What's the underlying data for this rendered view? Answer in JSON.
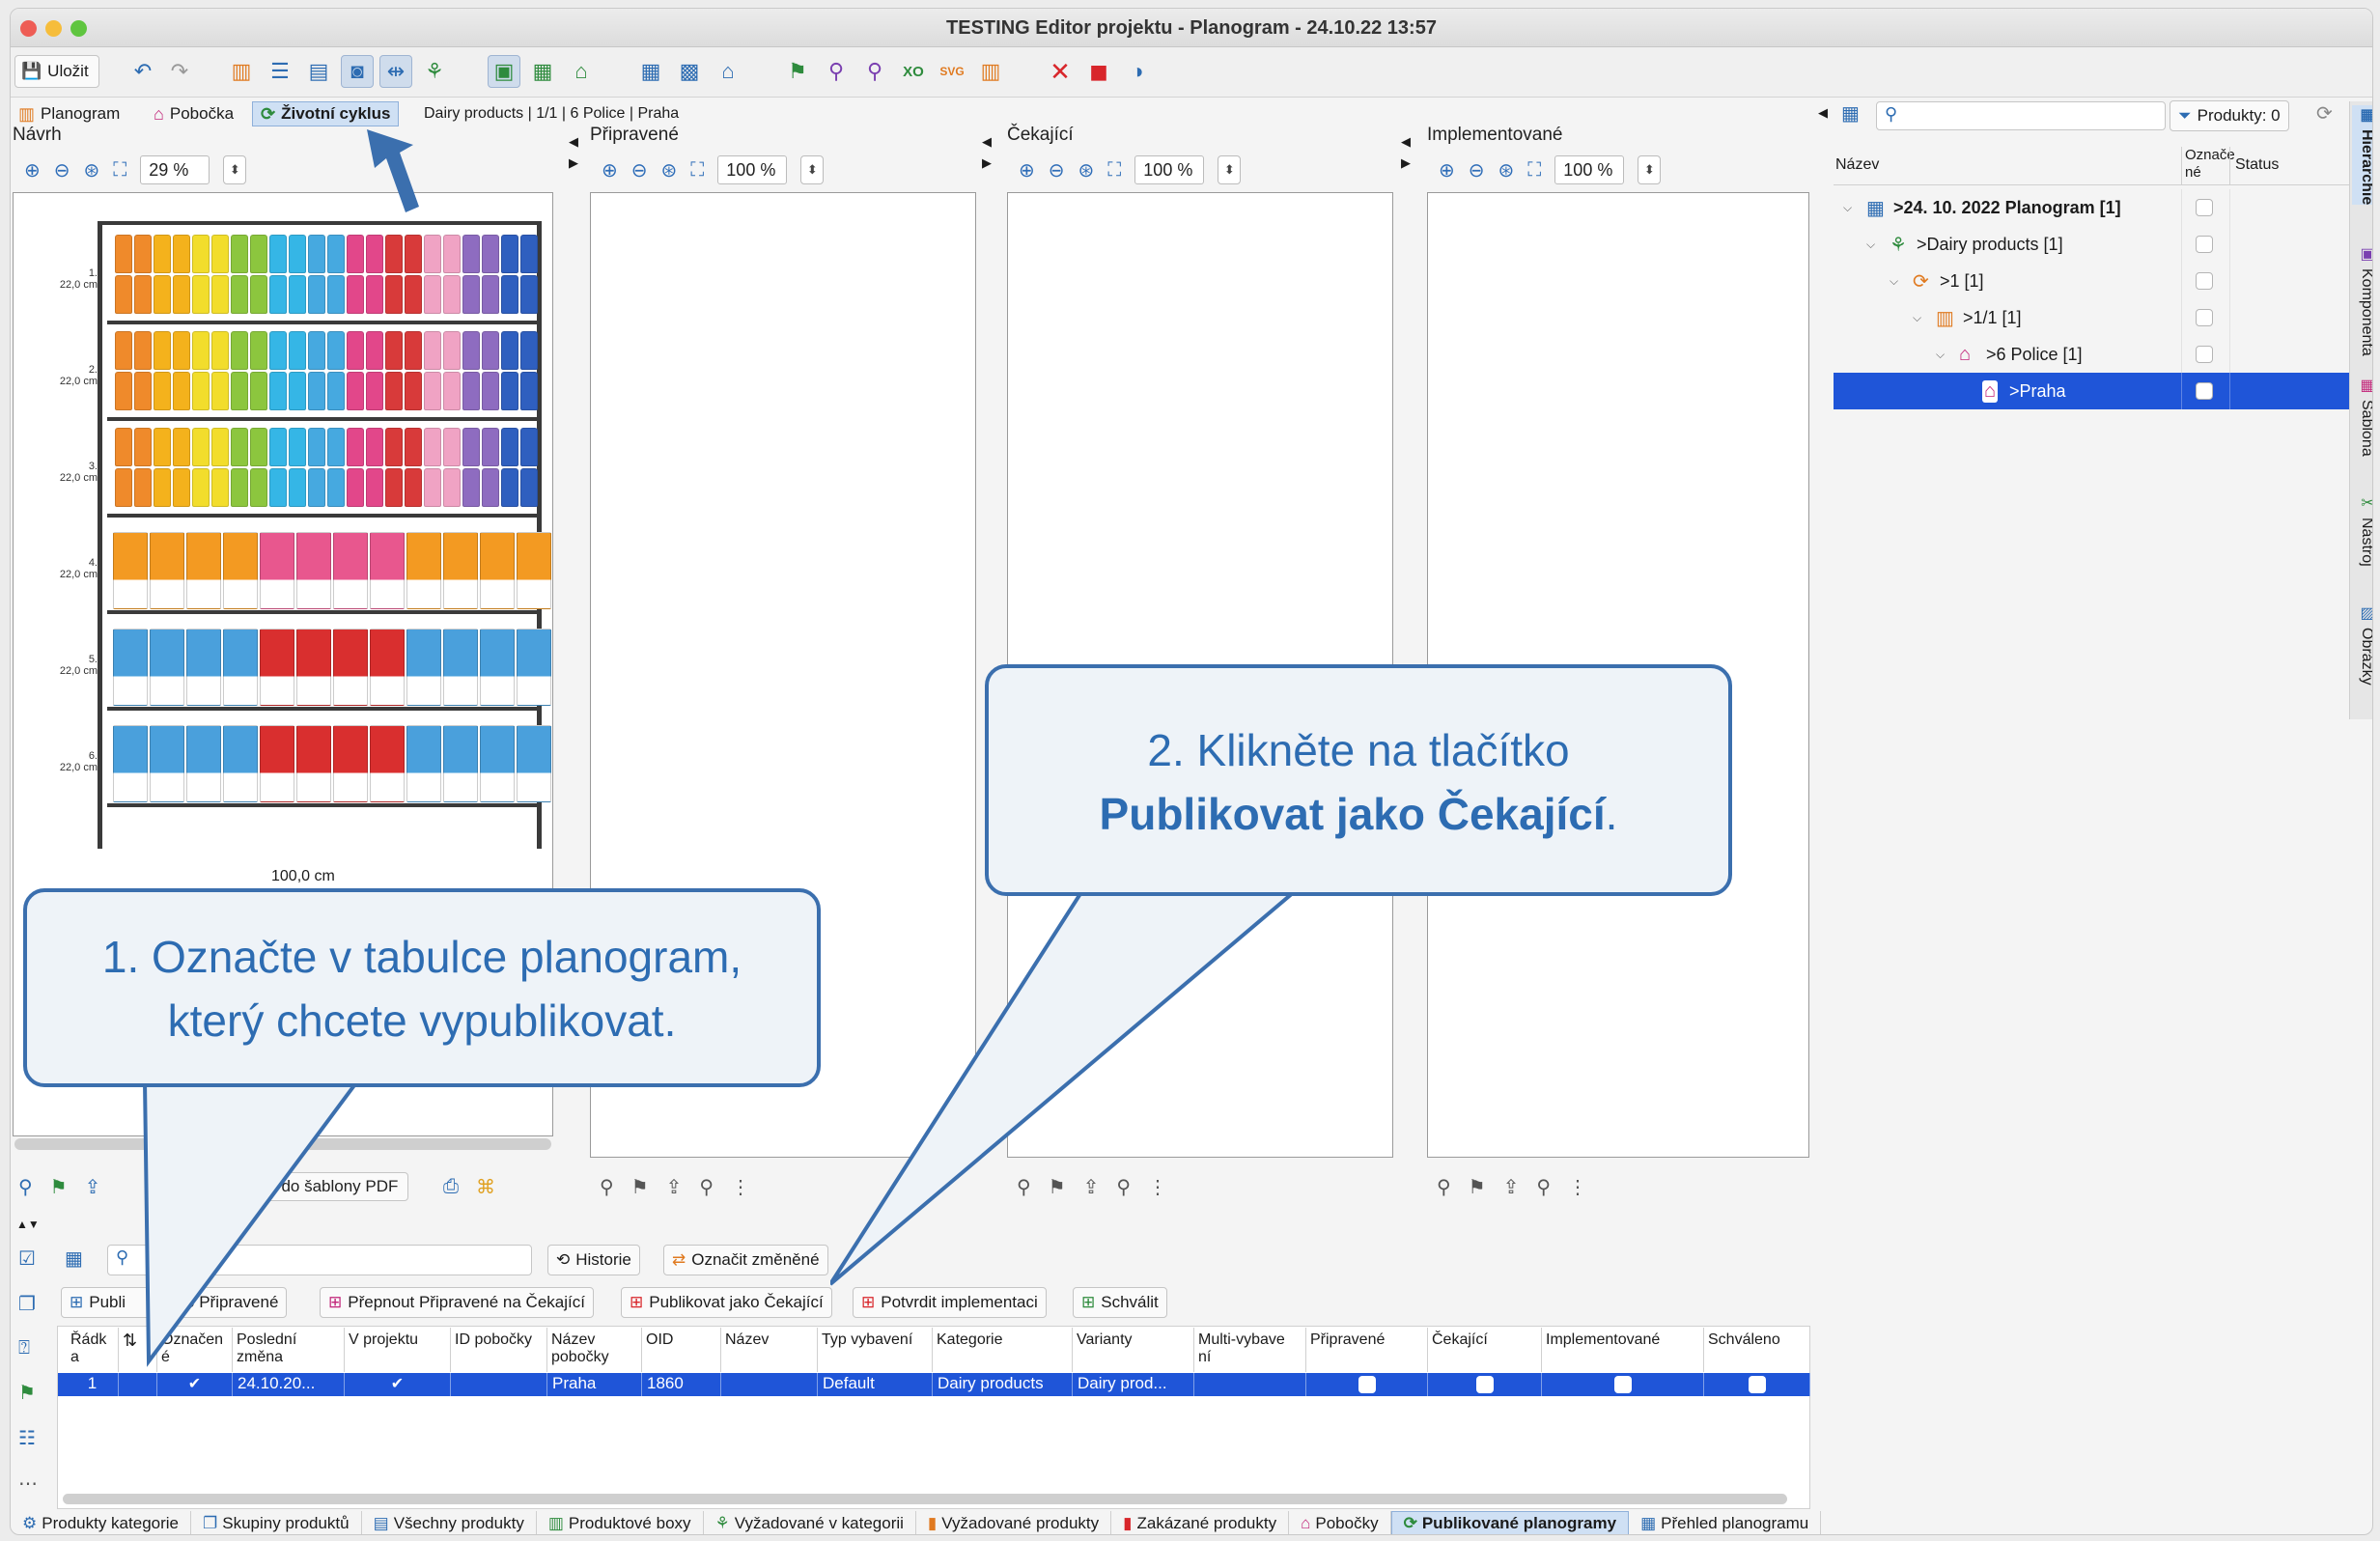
{
  "window": {
    "title": "TESTING Editor projektu - Planogram - 24.10.22 13:57"
  },
  "toolbar": {
    "save_label": "Uložit",
    "icons": [
      "undo-icon",
      "redo-icon",
      "align-icon",
      "list-icon",
      "columns-icon",
      "camera-icon",
      "ruler-icon",
      "tree-icon",
      "image-icon",
      "grid-icon",
      "home-icon",
      "table-icon",
      "map-icon",
      "store-icon",
      "flag-icon",
      "chart-icon",
      "chart2-icon",
      "xo-icon",
      "svg-icon",
      "shelf-icon",
      "close-icon",
      "stop-icon",
      "eye-off-icon"
    ]
  },
  "tabs": {
    "planogram": "Planogram",
    "pobocka": "Pobočka",
    "zivotni_cyklus": "Životní cyklus",
    "breadcrumb": "Dairy products | 1/1 | 6 Police | Praha"
  },
  "panels": {
    "navrh": {
      "label": "Návrh",
      "zoom": "29 %",
      "width_label": "100,0 cm",
      "pdf_button": "t do šablony PDF"
    },
    "pripravene": {
      "label": "Připravené",
      "zoom": "100 %"
    },
    "cekajici": {
      "label": "Čekající",
      "zoom": "100 %"
    },
    "implementovane": {
      "label": "Implementované",
      "zoom": "100 %"
    }
  },
  "shelves": [
    {
      "num": "1.",
      "height": "22,0 cm"
    },
    {
      "num": "2.",
      "height": "22,0 cm"
    },
    {
      "num": "3.",
      "height": "22,0 cm"
    },
    {
      "num": "4.",
      "height": "22,0 cm"
    },
    {
      "num": "5.",
      "height": "22,0 cm"
    },
    {
      "num": "6.",
      "height": "22,0 cm"
    }
  ],
  "callouts": {
    "one_line1": "1. Označte v tabulce planogram,",
    "one_line2": "který chcete vypublikovat.",
    "two_line1": "2. Klikněte na tlačítko",
    "two_bold": "Publikovat jako Čekající",
    "two_tail": "."
  },
  "hierarchy": {
    "products_label": "Produkty: 0",
    "col_name": "Název",
    "col_marked": "Označe né",
    "col_status": "Status",
    "rows": [
      {
        "label": ">24. 10. 2022 Planogram [1]",
        "icon": "planogram-icon"
      },
      {
        "label": ">Dairy products [1]",
        "icon": "category-icon"
      },
      {
        "label": ">1 [1]",
        "icon": "cycle-icon"
      },
      {
        "label": ">1/1 [1]",
        "icon": "shelf-icon"
      },
      {
        "label": ">6 Police [1]",
        "icon": "police-icon"
      },
      {
        "label": ">Praha",
        "icon": "branch-icon"
      }
    ]
  },
  "side_tabs": [
    "Hierarchie",
    "Komponenta",
    "Šablona",
    "Nástroj",
    "Obrázky"
  ],
  "table_toolbar": {
    "historie": "Historie",
    "oznacit_zmenene": "Označit změněné",
    "publikovat_pripravene_a": "Publi",
    "publikovat_pripravene_b": "ako Připravené",
    "prepnout": "Přepnout Připravené na Čekající",
    "publikovat_cekajici": "Publikovat jako Čekající",
    "potvrdit": "Potvrdit implementaci",
    "schvalit": "Schválit"
  },
  "table": {
    "headers": [
      "Řádk a",
      "",
      "Označen é",
      "Poslední změna",
      "V projektu",
      "ID pobočky",
      "Název pobočky",
      "OID",
      "Název",
      "Typ vybavení",
      "Kategorie",
      "Varianty",
      "Multi-vybave ní",
      "Připravené",
      "Čekající",
      "Implementované",
      "Schváleno"
    ],
    "row": {
      "radek": "1",
      "posledni_zmena": "24.10.20...",
      "nazev_pobocky": "Praha",
      "oid": "1860",
      "typ": "Default",
      "kategorie": "Dairy products",
      "varianty": "Dairy prod..."
    }
  },
  "bottom_tabs": [
    "Produkty kategorie",
    "Skupiny produktů",
    "Všechny produkty",
    "Produktové boxy",
    "Vyžadované v kategorii",
    "Vyžadované produkty",
    "Zakázané produkty",
    "Pobočky",
    "Publikované planogramy",
    "Přehled planogramu"
  ],
  "colors": {
    "accent": "#1f55d8",
    "callout_border": "#3b6fae",
    "callout_text": "#2d6cb2"
  }
}
